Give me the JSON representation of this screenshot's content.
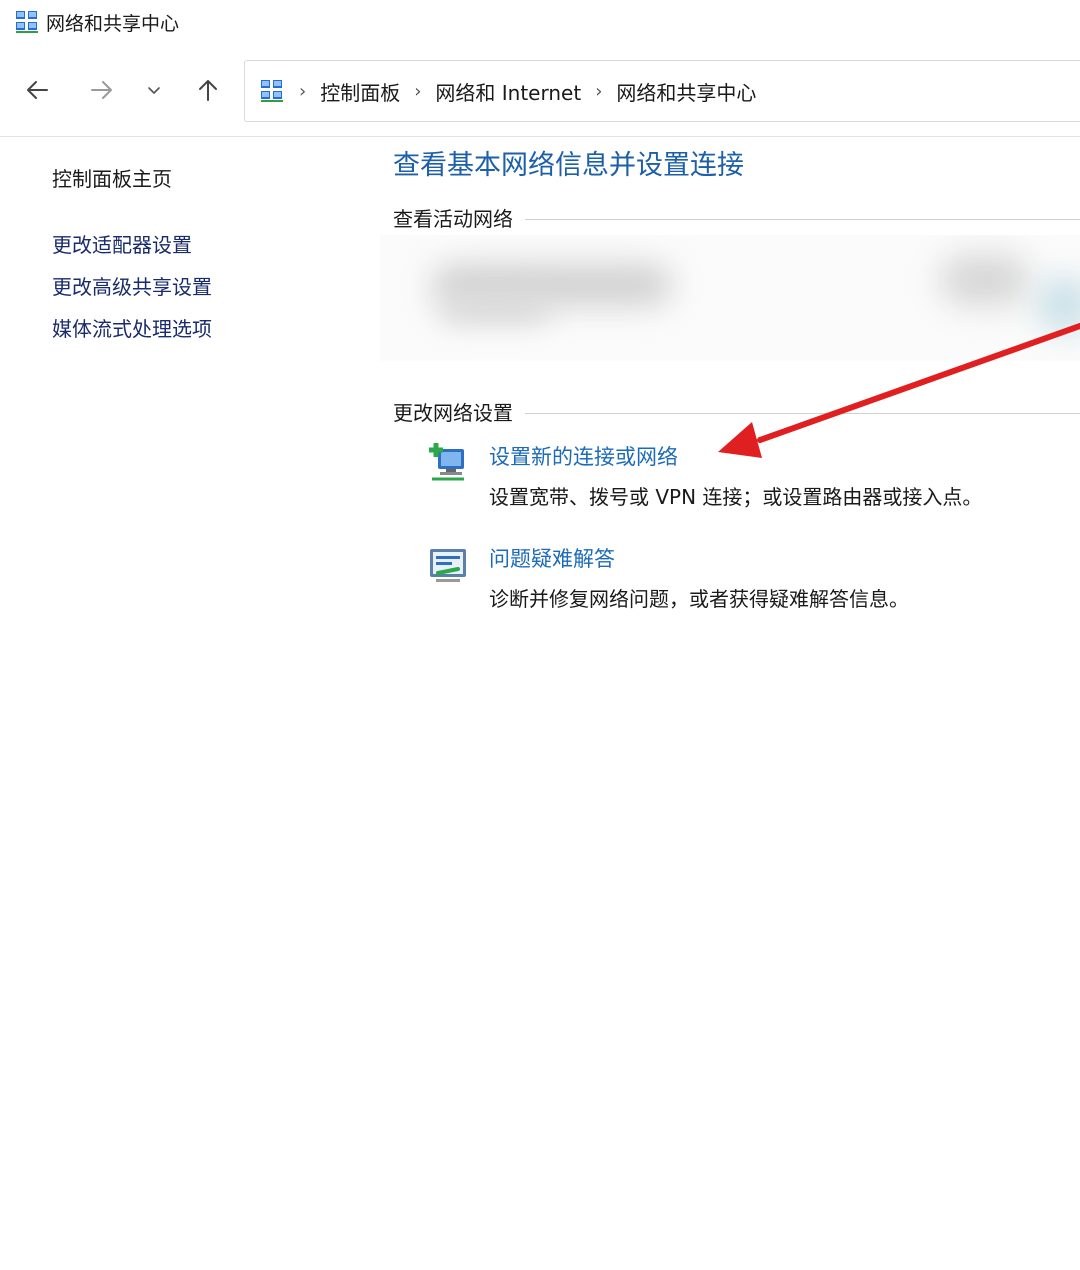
{
  "window": {
    "title": "网络和共享中心",
    "icon": "network-center-icon"
  },
  "nav": {
    "back_icon": "back-arrow-icon",
    "forward_icon": "forward-arrow-icon",
    "recent_icon": "chevron-down-icon",
    "up_icon": "up-arrow-icon"
  },
  "address_bar": {
    "icon": "network-center-icon",
    "breadcrumbs": [
      "控制面板",
      "网络和 Internet",
      "网络和共享中心"
    ]
  },
  "sidebar": {
    "home": "控制面板主页",
    "links": [
      "更改适配器设置",
      "更改高级共享设置",
      "媒体流式处理选项"
    ]
  },
  "main": {
    "title": "查看基本网络信息并设置连接",
    "active_networks_heading": "查看活动网络",
    "change_settings_heading": "更改网络设置",
    "tasks": [
      {
        "icon": "new-connection-icon",
        "label": "设置新的连接或网络",
        "description": "设置宽带、拨号或 VPN 连接；或设置路由器或接入点。"
      },
      {
        "icon": "troubleshoot-icon",
        "label": "问题疑难解答",
        "description": "诊断并修复网络问题，或者获得疑难解答信息。"
      }
    ]
  },
  "colors": {
    "link": "#1d6bb8",
    "title": "#1d5fa8",
    "annotation_arrow": "#e02020"
  }
}
